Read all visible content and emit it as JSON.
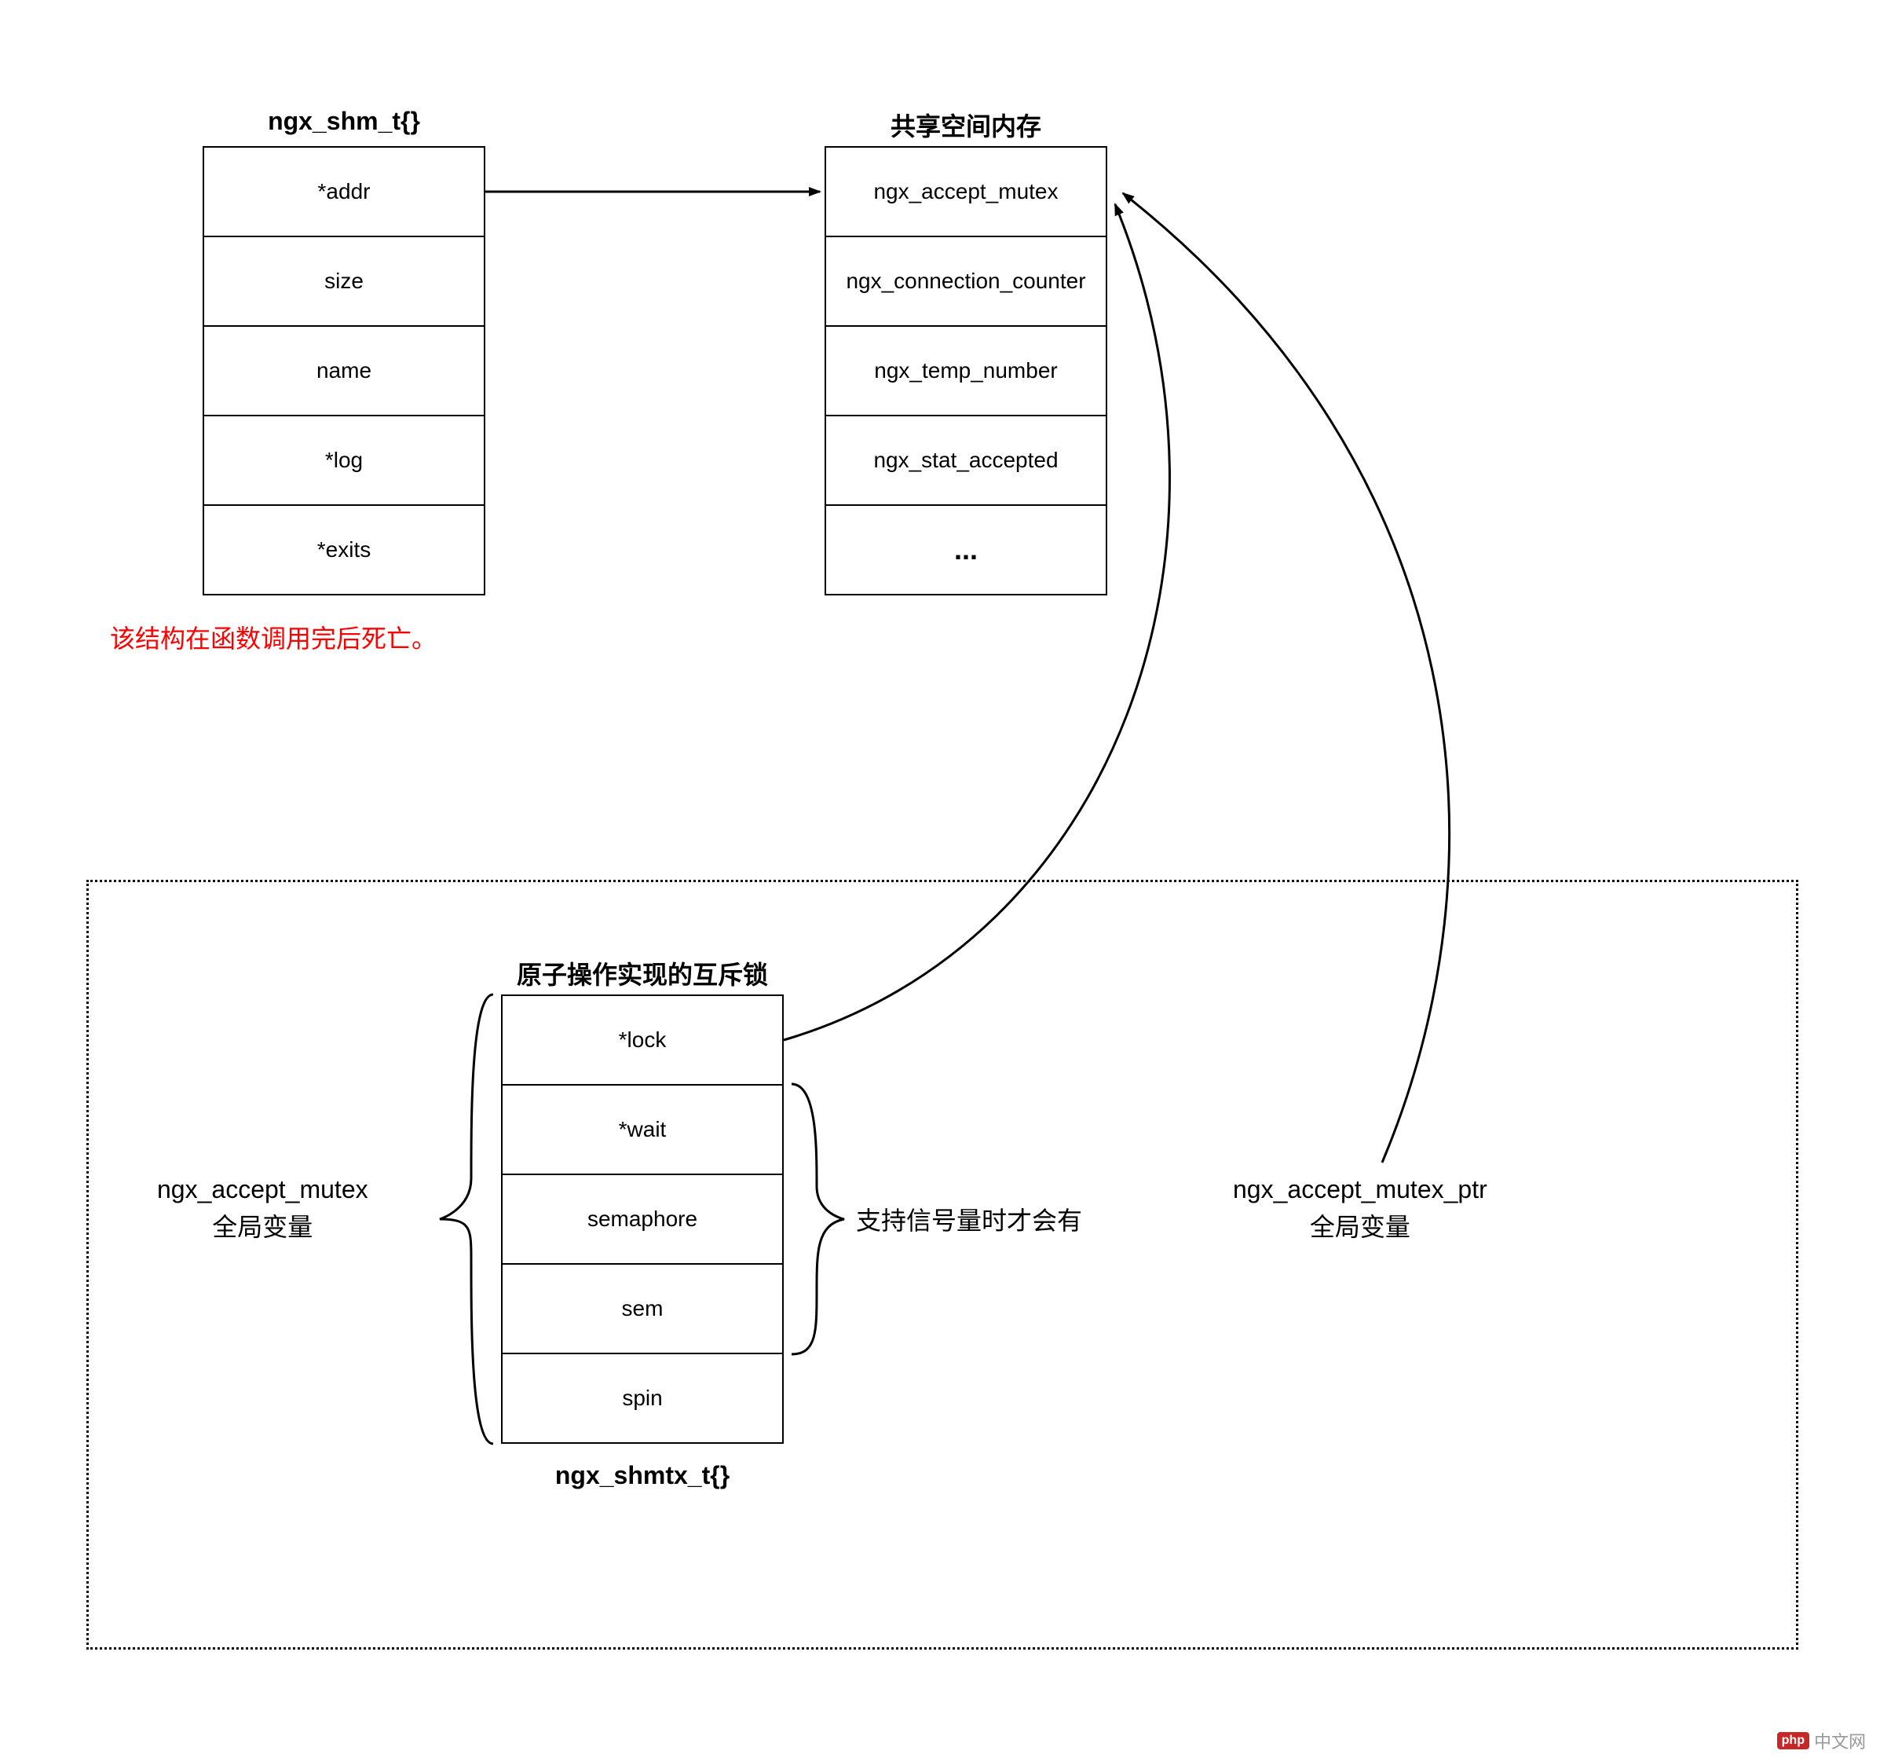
{
  "struct1": {
    "title": "ngx_shm_t{}",
    "fields": [
      "*addr",
      "size",
      "name",
      "*log",
      "*exits"
    ],
    "note": "该结构在函数调用完后死亡。"
  },
  "shared": {
    "title": "共享空间内存",
    "fields": [
      "ngx_accept_mutex",
      "ngx_connection_counter",
      "ngx_temp_number",
      "ngx_stat_accepted",
      "..."
    ]
  },
  "struct2": {
    "title_top": "原子操作实现的互斥锁",
    "title_bottom": "ngx_shmtx_t{}",
    "fields": [
      "*lock",
      "*wait",
      "semaphore",
      "sem",
      "spin"
    ]
  },
  "labels": {
    "left": {
      "line1": "ngx_accept_mutex",
      "line2": "全局变量"
    },
    "right_brace": "支持信号量时才会有",
    "right_var": {
      "line1": "ngx_accept_mutex_ptr",
      "line2": "全局变量"
    }
  },
  "watermark": {
    "badge": "php",
    "text": "中文网"
  }
}
